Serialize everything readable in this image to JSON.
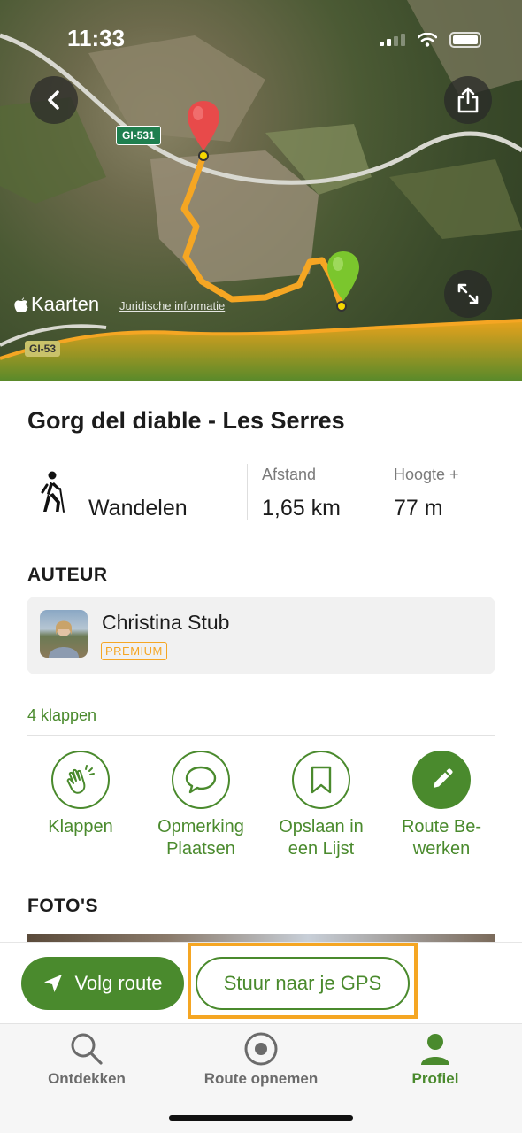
{
  "status_bar": {
    "time": "11:33"
  },
  "map": {
    "road_label_1": "GI-531",
    "road_label_2": "GI-53",
    "maps_brand": "Kaarten",
    "legal_link": "Juridische informatie",
    "route_color": "#f5a623",
    "start_pin_color": "#7bc62d",
    "end_pin_color": "#e84a4a"
  },
  "route": {
    "title": "Gorg del diable - Les Serres",
    "activity": "Wandelen",
    "distance_label": "Afstand",
    "distance_value": "1,65 km",
    "elevation_label": "Hoogte +",
    "elevation_value": "77 m"
  },
  "author": {
    "section_title": "AUTEUR",
    "name": "Christina Stub",
    "badge": "PREMIUM"
  },
  "social": {
    "claps": "4 klappen",
    "actions": [
      {
        "label_line1": "Klappen",
        "label_line2": "",
        "icon": "clap-icon"
      },
      {
        "label_line1": "Opmerking",
        "label_line2": "Plaatsen",
        "icon": "comment-icon"
      },
      {
        "label_line1": "Opslaan in",
        "label_line2": "een Lijst",
        "icon": "bookmark-icon"
      },
      {
        "label_line1": "Route Be-",
        "label_line2": "werken",
        "icon": "pencil-icon"
      }
    ]
  },
  "photos": {
    "section_title": "FOTO'S"
  },
  "bottom_actions": {
    "follow_route": "Volg route",
    "send_to_gps": "Stuur naar je GPS"
  },
  "tabbar": {
    "tabs": [
      {
        "label": "Ontdekken",
        "icon": "search-icon"
      },
      {
        "label": "Route opnemen",
        "icon": "record-icon"
      },
      {
        "label": "Profiel",
        "icon": "person-icon",
        "active": true
      }
    ]
  },
  "colors": {
    "brand_green": "#4a8a2d",
    "highlight_orange": "#f5a623"
  }
}
